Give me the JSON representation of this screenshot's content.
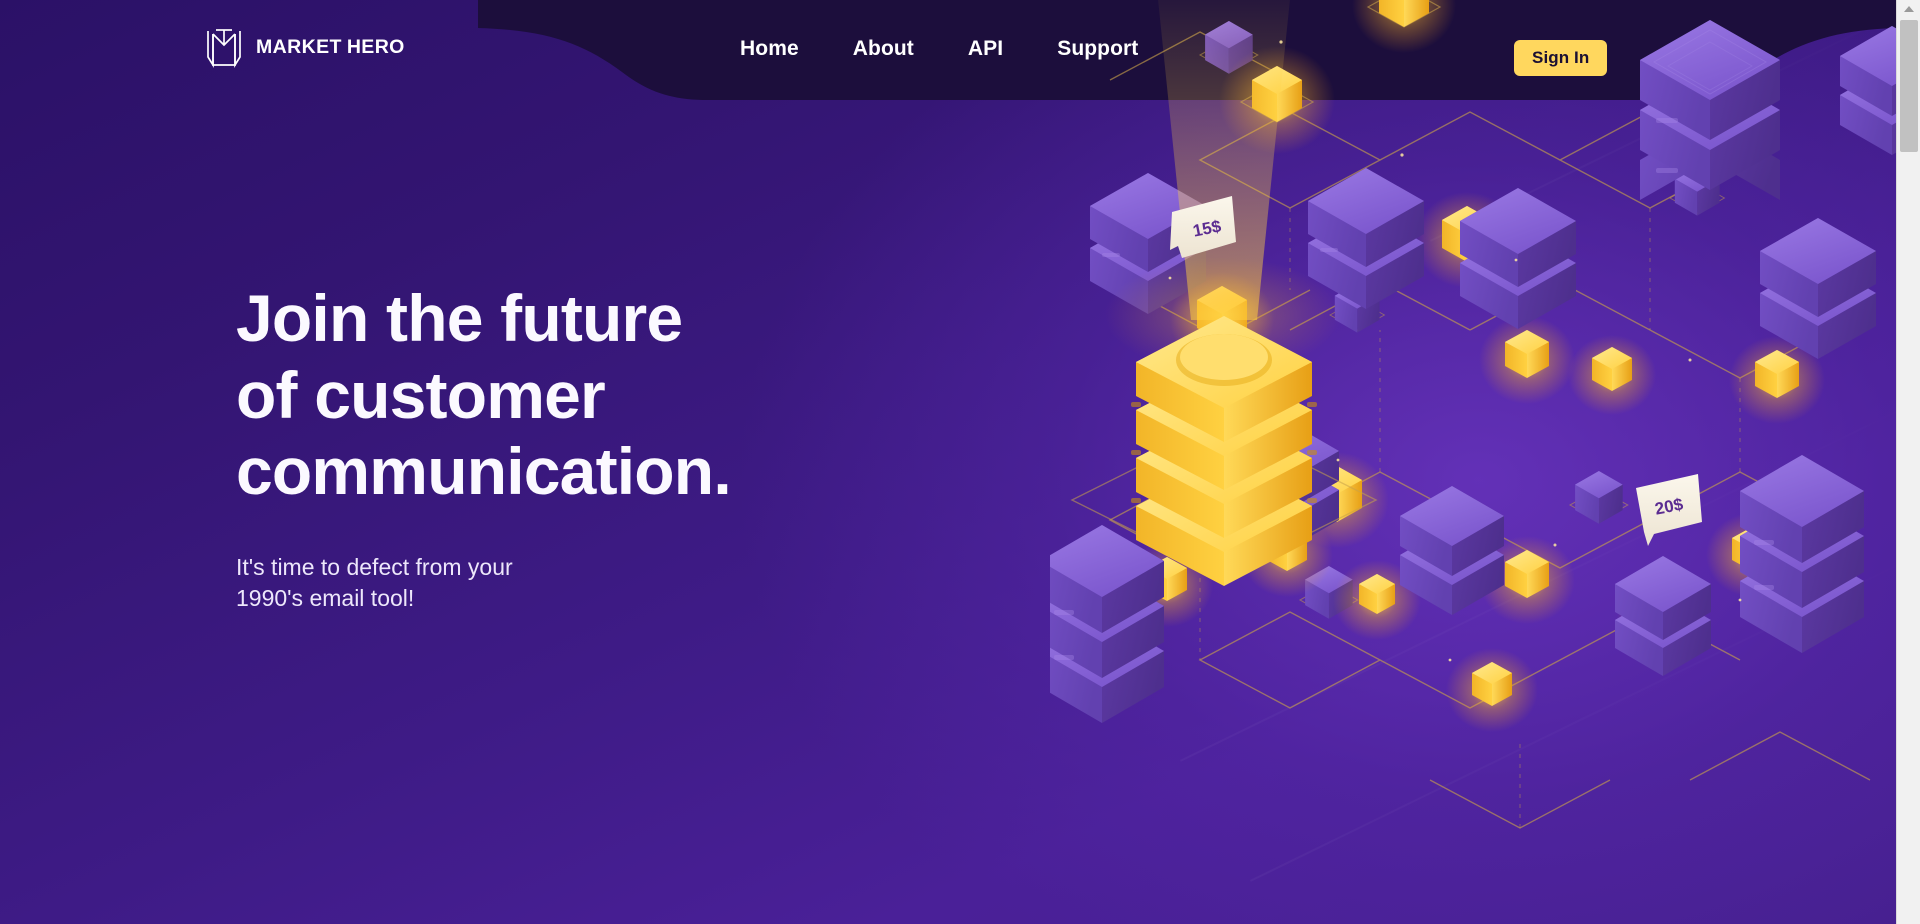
{
  "page": {
    "title": "Market Hero",
    "bg_top": "#2B1167",
    "bg_bottom": "#46208F",
    "nav_band_color": "#1C0E3C",
    "accent": "#FFD75E",
    "accent_text": "#1B1033"
  },
  "header": {
    "logo": {
      "mark_icon": "market-hero-monogram-icon",
      "word_one": "MARKET",
      "word_two": "HERO"
    },
    "nav": [
      {
        "label": "Home",
        "name": "nav-link-home"
      },
      {
        "label": "About",
        "name": "nav-link-about"
      },
      {
        "label": "API",
        "name": "nav-link-api"
      },
      {
        "label": "Support",
        "name": "nav-link-support"
      }
    ],
    "signin_label": "Sign In"
  },
  "hero": {
    "title": "Join the future\nof customer\ncommunication.",
    "subtitle": "It's time to defect from your\n1990's email tool!"
  },
  "illustration": {
    "name": "isometric-network-illustration",
    "price_tags": [
      {
        "label": "15$",
        "name": "price-tag-15"
      },
      {
        "label": "20$",
        "name": "price-tag-20"
      }
    ],
    "colors": {
      "gold": "#FFD141",
      "gold_light": "#FFE585",
      "gold_dark": "#E8A81C",
      "server_top": "#8A66D8",
      "server_left": "#6C47BE",
      "server_right": "#5A37A6",
      "wire": "#C9A24A",
      "tag_bg": "#F6F1E4",
      "tag_text": "#5B2C91"
    }
  },
  "scrollbar": {
    "up_arrow_icon": "chevron-up-icon",
    "thumb_name": "scrollbar-thumb"
  }
}
